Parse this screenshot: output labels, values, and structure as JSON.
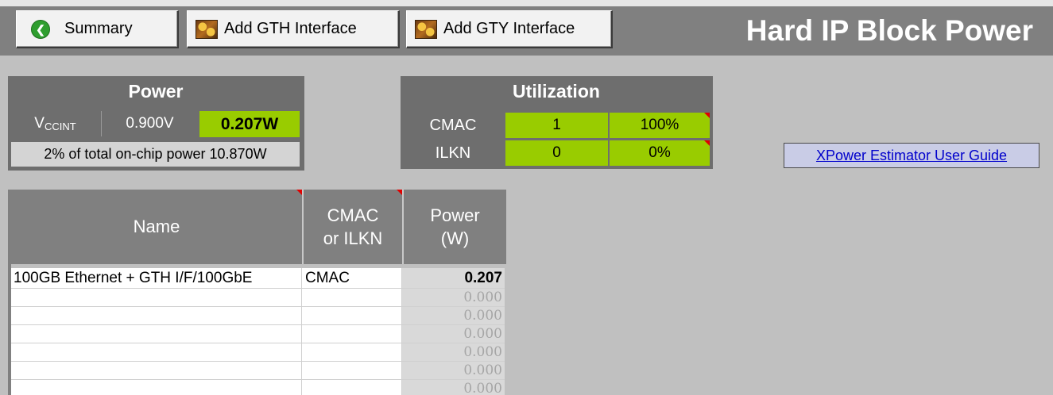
{
  "toolbar": {
    "summary_label": "Summary",
    "add_gth_label": "Add GTH Interface",
    "add_gty_label": "Add GTY Interface",
    "title": "Hard IP Block Power"
  },
  "power": {
    "header": "Power",
    "rail_main": "V",
    "rail_sub": "CCINT",
    "voltage": "0.900V",
    "watts": "0.207W",
    "total_note": "2% of total on-chip power 10.870W"
  },
  "utilization": {
    "header": "Utilization",
    "rows": [
      {
        "label": "CMAC",
        "count": "1",
        "percent": "100%"
      },
      {
        "label": "ILKN",
        "count": "0",
        "percent": "0%"
      }
    ]
  },
  "guide_link": "XPower Estimator User Guide",
  "table": {
    "headers": {
      "name": "Name",
      "type_1": "CMAC",
      "type_2": "or ILKN",
      "power_1": "Power",
      "power_2": "(W)"
    },
    "rows": [
      {
        "name": "100GB Ethernet + GTH I/F/100GbE",
        "type": "CMAC",
        "power": "0.207"
      },
      {
        "name": "",
        "type": "",
        "power": "0.000"
      },
      {
        "name": "",
        "type": "",
        "power": "0.000"
      },
      {
        "name": "",
        "type": "",
        "power": "0.000"
      },
      {
        "name": "",
        "type": "",
        "power": "0.000"
      },
      {
        "name": "",
        "type": "",
        "power": "0.000"
      }
    ]
  },
  "colors": {
    "accent_green": "#99cc00",
    "header_gray": "#6e6e6e",
    "link_blue": "#0000cc"
  }
}
